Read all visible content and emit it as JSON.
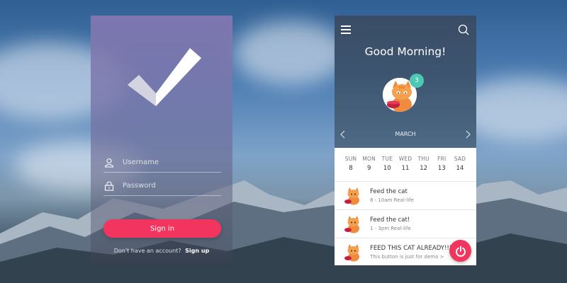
{
  "login": {
    "username_placeholder": "Username",
    "password_placeholder": "Password",
    "signin_label": "Sign in",
    "signup_prompt": "Don't have an account?",
    "signup_link": "Sign up"
  },
  "app": {
    "greeting": "Good Morning!",
    "notification_count": "3",
    "month": "MARCH",
    "week": [
      {
        "day": "SUN",
        "date": "8"
      },
      {
        "day": "MON",
        "date": "9"
      },
      {
        "day": "TUE",
        "date": "10"
      },
      {
        "day": "WED",
        "date": "11"
      },
      {
        "day": "THU",
        "date": "12"
      },
      {
        "day": "FRI",
        "date": "13"
      },
      {
        "day": "SAD",
        "date": "14"
      }
    ],
    "tasks": [
      {
        "title": "Feed the cat",
        "subtitle": "8 - 10am Real-life"
      },
      {
        "title": "Feed the cat!",
        "subtitle": "1 - 3pm Real-life"
      },
      {
        "title": "FEED THIS CAT ALREADY!!!",
        "subtitle": "This button is just for demo >"
      }
    ]
  },
  "colors": {
    "accent": "#f2355e",
    "badge": "#4cc9b3",
    "header": "#3d5570"
  },
  "icons": [
    "checkmark-logo-icon",
    "user-icon",
    "lock-icon",
    "menu-icon",
    "search-icon",
    "chevron-left-icon",
    "chevron-right-icon",
    "power-icon",
    "cat-avatar"
  ]
}
